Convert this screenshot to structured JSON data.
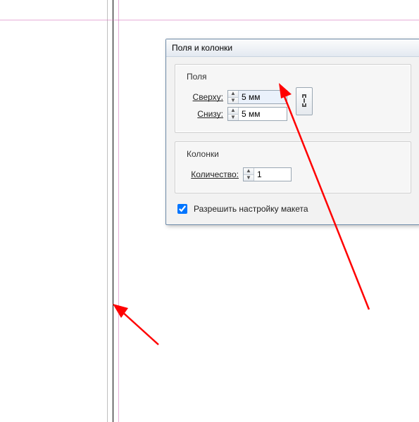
{
  "dialog": {
    "title": "Поля и колонки",
    "margins": {
      "legend": "Поля",
      "top_label": "Сверху:",
      "top_value": "5 мм",
      "bottom_label": "Снизу:",
      "bottom_value": "5 мм"
    },
    "columns": {
      "legend": "Колонки",
      "count_label": "Количество:",
      "count_value": "1"
    },
    "allow_layout_label": "Разрешить настройку макета",
    "allow_layout_checked": true
  }
}
